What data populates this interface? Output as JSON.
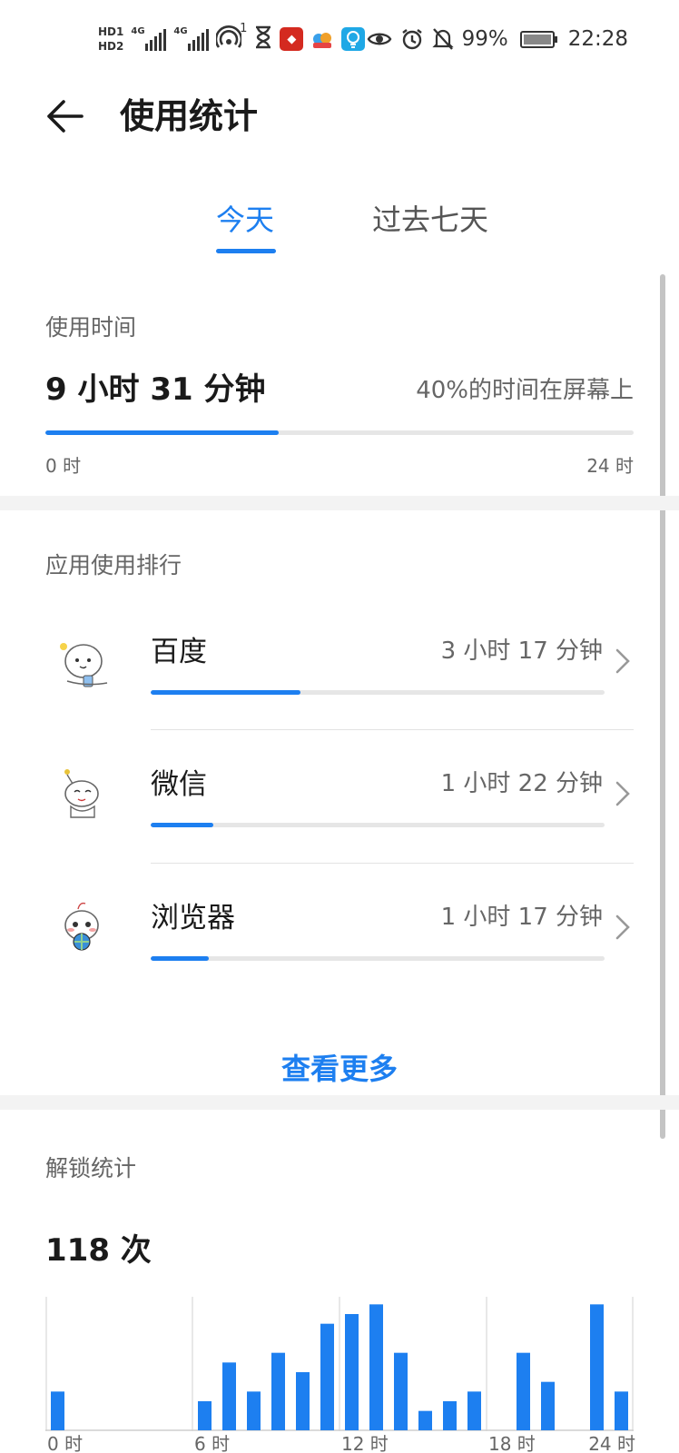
{
  "status_bar": {
    "hd1": "HD1",
    "hd2": "HD2",
    "net1": "4G",
    "net2": "4G",
    "hotspot_count": "1",
    "icons_left": [
      "sim-hd-icon",
      "signal-icon",
      "signal-icon",
      "hotspot-icon",
      "hourglass-icon",
      "red-app-icon",
      "cloud-app-icon",
      "bulb-app-icon"
    ],
    "icons_right": [
      "eye-icon",
      "alarm-icon",
      "mute-bell-icon",
      "battery-icon"
    ],
    "battery": "99%",
    "time": "22:28"
  },
  "header": {
    "title": "使用统计"
  },
  "tabs": [
    {
      "label": "今天",
      "active": true
    },
    {
      "label": "过去七天",
      "active": false
    }
  ],
  "usage": {
    "label": "使用时间",
    "value": "9 小时 31 分钟",
    "note": "40%的时间在屏幕上",
    "fraction": 0.396,
    "axis_start": "0 时",
    "axis_end": "24 时"
  },
  "ranking": {
    "label": "应用使用排行",
    "apps": [
      {
        "name": "百度",
        "time": "3 小时 17 分钟",
        "fraction": 0.33
      },
      {
        "name": "微信",
        "time": "1 小时 22 分钟",
        "fraction": 0.137
      },
      {
        "name": "浏览器",
        "time": "1 小时 17 分钟",
        "fraction": 0.128
      }
    ],
    "see_more": "查看更多"
  },
  "unlock": {
    "label": "解锁统计",
    "count": "118 次"
  },
  "colors": {
    "accent": "#1d7ff0",
    "track": "#e6e6e6",
    "text_primary": "#1a1a1a",
    "text_secondary": "#666666"
  },
  "chart_data": {
    "type": "bar",
    "categories": [
      "0",
      "1",
      "2",
      "3",
      "4",
      "5",
      "6",
      "7",
      "8",
      "9",
      "10",
      "11",
      "12",
      "13",
      "14",
      "15",
      "16",
      "17",
      "18",
      "19",
      "20",
      "21",
      "22",
      "23"
    ],
    "values": [
      4,
      0,
      0,
      0,
      0,
      0,
      3,
      7,
      4,
      8,
      6,
      11,
      12,
      13,
      8,
      2,
      3,
      4,
      0,
      8,
      5,
      0,
      13,
      4
    ],
    "xlabel": "",
    "ylabel": "",
    "ylim": [
      0,
      13.5
    ],
    "grid": true,
    "tick_labels": [
      "0 时",
      "6 时",
      "12 时",
      "18 时",
      "24 时"
    ]
  }
}
